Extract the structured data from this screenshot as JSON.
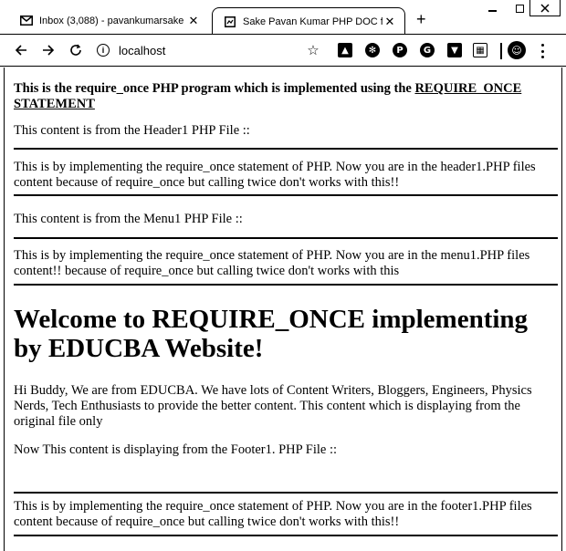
{
  "browser": {
    "tabs": [
      {
        "title": "Inbox (3,088) - pavankumarsake",
        "favicon": "gmail-icon",
        "active": false
      },
      {
        "title": "Sake Pavan Kumar PHP DOC for",
        "favicon": "page-icon",
        "active": true
      }
    ],
    "new_tab": "+",
    "url": "localhost"
  },
  "page": {
    "intro_text": "This is the require_once PHP program which is implemented using the ",
    "intro_link": "REQUIRE_ONCE STATEMENT",
    "header_label": "This content is from the Header1 PHP File ::",
    "header_text": "This is by implementing the require_once statement of PHP. Now you are in the header1.PHP files content because of require_once but calling twice don't works with this!!",
    "menu_label": "This content is from the Menu1 PHP File ::",
    "menu_text": "This is by implementing the require_once statement of PHP. Now you are in the menu1.PHP files content!! because of require_once but calling twice don't works with this",
    "heading": "Welcome to REQUIRE_ONCE implementing by EDUCBA Website!",
    "body_text": "Hi Buddy, We are from EDUCBA. We have lots of Content Writers, Bloggers, Engineers, Physics Nerds, Tech Enthusiasts to provide the better content. This content which is displaying from the original file only",
    "footer_label": "Now This content is displaying from the Footer1. PHP File ::",
    "footer_text": "This is by implementing the require_once statement of PHP. Now you are in the footer1.PHP files content because of require_once but calling twice don't works with this!!"
  }
}
